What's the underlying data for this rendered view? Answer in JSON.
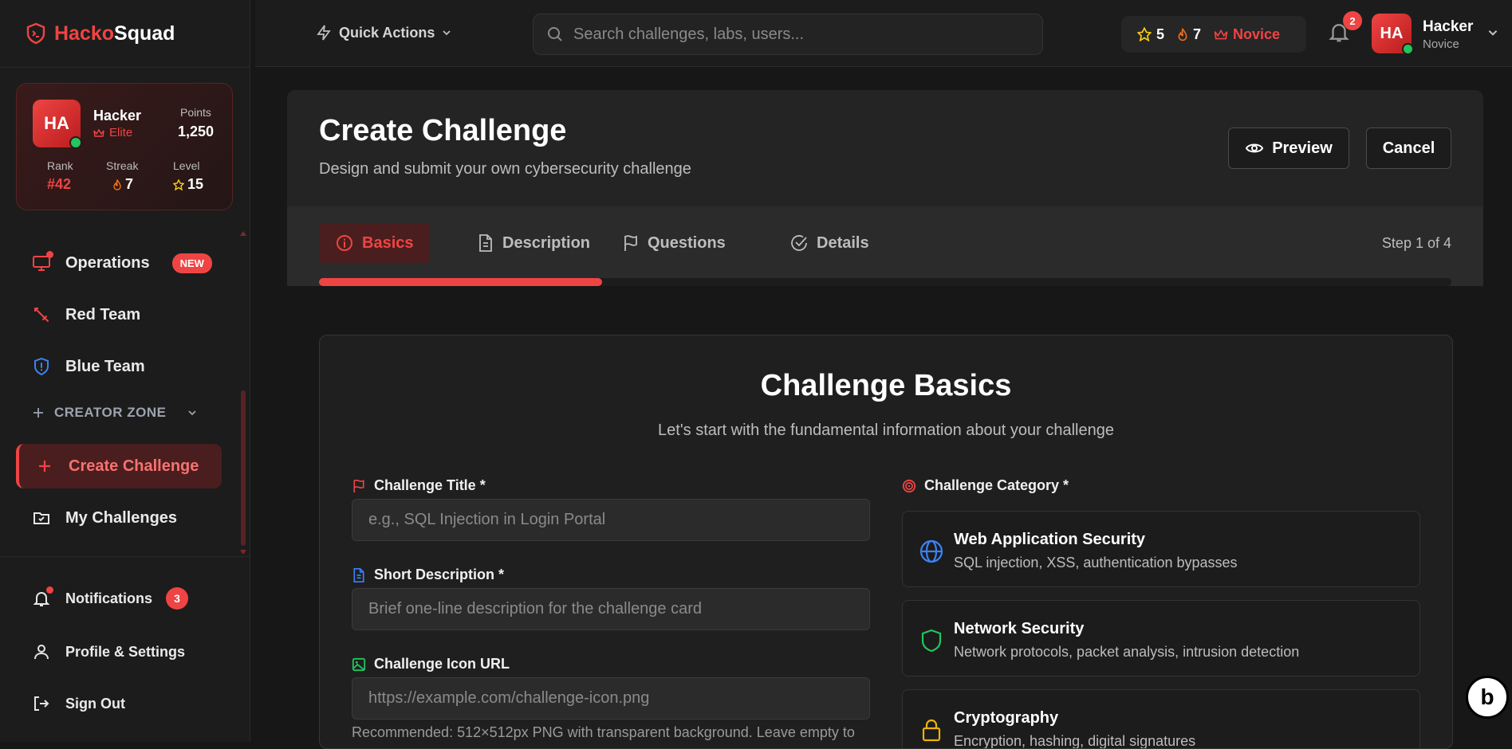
{
  "app": {
    "brand_part1": "Hacko",
    "brand_part2": "Squad"
  },
  "sidebar": {
    "profile": {
      "initials": "HA",
      "name": "Hacker",
      "tier": "Elite",
      "points_label": "Points",
      "points": "1,250",
      "rank_label": "Rank",
      "rank": "#42",
      "streak_label": "Streak",
      "streak": "7",
      "level_label": "Level",
      "level": "15"
    },
    "items": [
      {
        "label": "Operations",
        "badge": "NEW"
      },
      {
        "label": "Red Team"
      },
      {
        "label": "Blue Team"
      }
    ],
    "creator_zone": "CREATOR ZONE",
    "creator_items": [
      {
        "label": "Create Challenge"
      },
      {
        "label": "My Challenges"
      }
    ],
    "bottom": [
      {
        "label": "Notifications",
        "count": "3"
      },
      {
        "label": "Profile & Settings"
      },
      {
        "label": "Sign Out"
      }
    ]
  },
  "topbar": {
    "quick_actions": "Quick Actions",
    "search_placeholder": "Search challenges, labs, users...",
    "stars": "5",
    "streak": "7",
    "tier": "Novice",
    "notif_count": "2",
    "user_initials": "HA",
    "user_name": "Hacker",
    "user_tier": "Novice"
  },
  "page": {
    "title": "Create Challenge",
    "subtitle": "Design and submit your own cybersecurity challenge",
    "preview_label": "Preview",
    "cancel_label": "Cancel",
    "tabs": [
      {
        "label": "Basics"
      },
      {
        "label": "Description"
      },
      {
        "label": "Questions"
      },
      {
        "label": "Details"
      }
    ],
    "step": "Step 1 of 4",
    "progress": 0.25
  },
  "form": {
    "title": "Challenge Basics",
    "subtitle": "Let's start with the fundamental information about your challenge",
    "title_label": "Challenge Title *",
    "title_placeholder": "e.g., SQL Injection in Login Portal",
    "desc_label": "Short Description *",
    "desc_placeholder": "Brief one-line description for the challenge card",
    "icon_label": "Challenge Icon URL",
    "icon_placeholder": "https://example.com/challenge-icon.png",
    "icon_hint": "Recommended: 512×512px PNG with transparent background. Leave empty to",
    "category_label": "Challenge Category *",
    "categories": [
      {
        "title": "Web Application Security",
        "desc": "SQL injection, XSS, authentication bypasses"
      },
      {
        "title": "Network Security",
        "desc": "Network protocols, packet analysis, intrusion detection"
      },
      {
        "title": "Cryptography",
        "desc": "Encryption, hashing, digital signatures"
      }
    ]
  },
  "colors": {
    "accent": "#ef4444",
    "bg": "#171717",
    "success": "#22c55e",
    "star": "#facc15"
  },
  "badge": {
    "text": "b"
  }
}
